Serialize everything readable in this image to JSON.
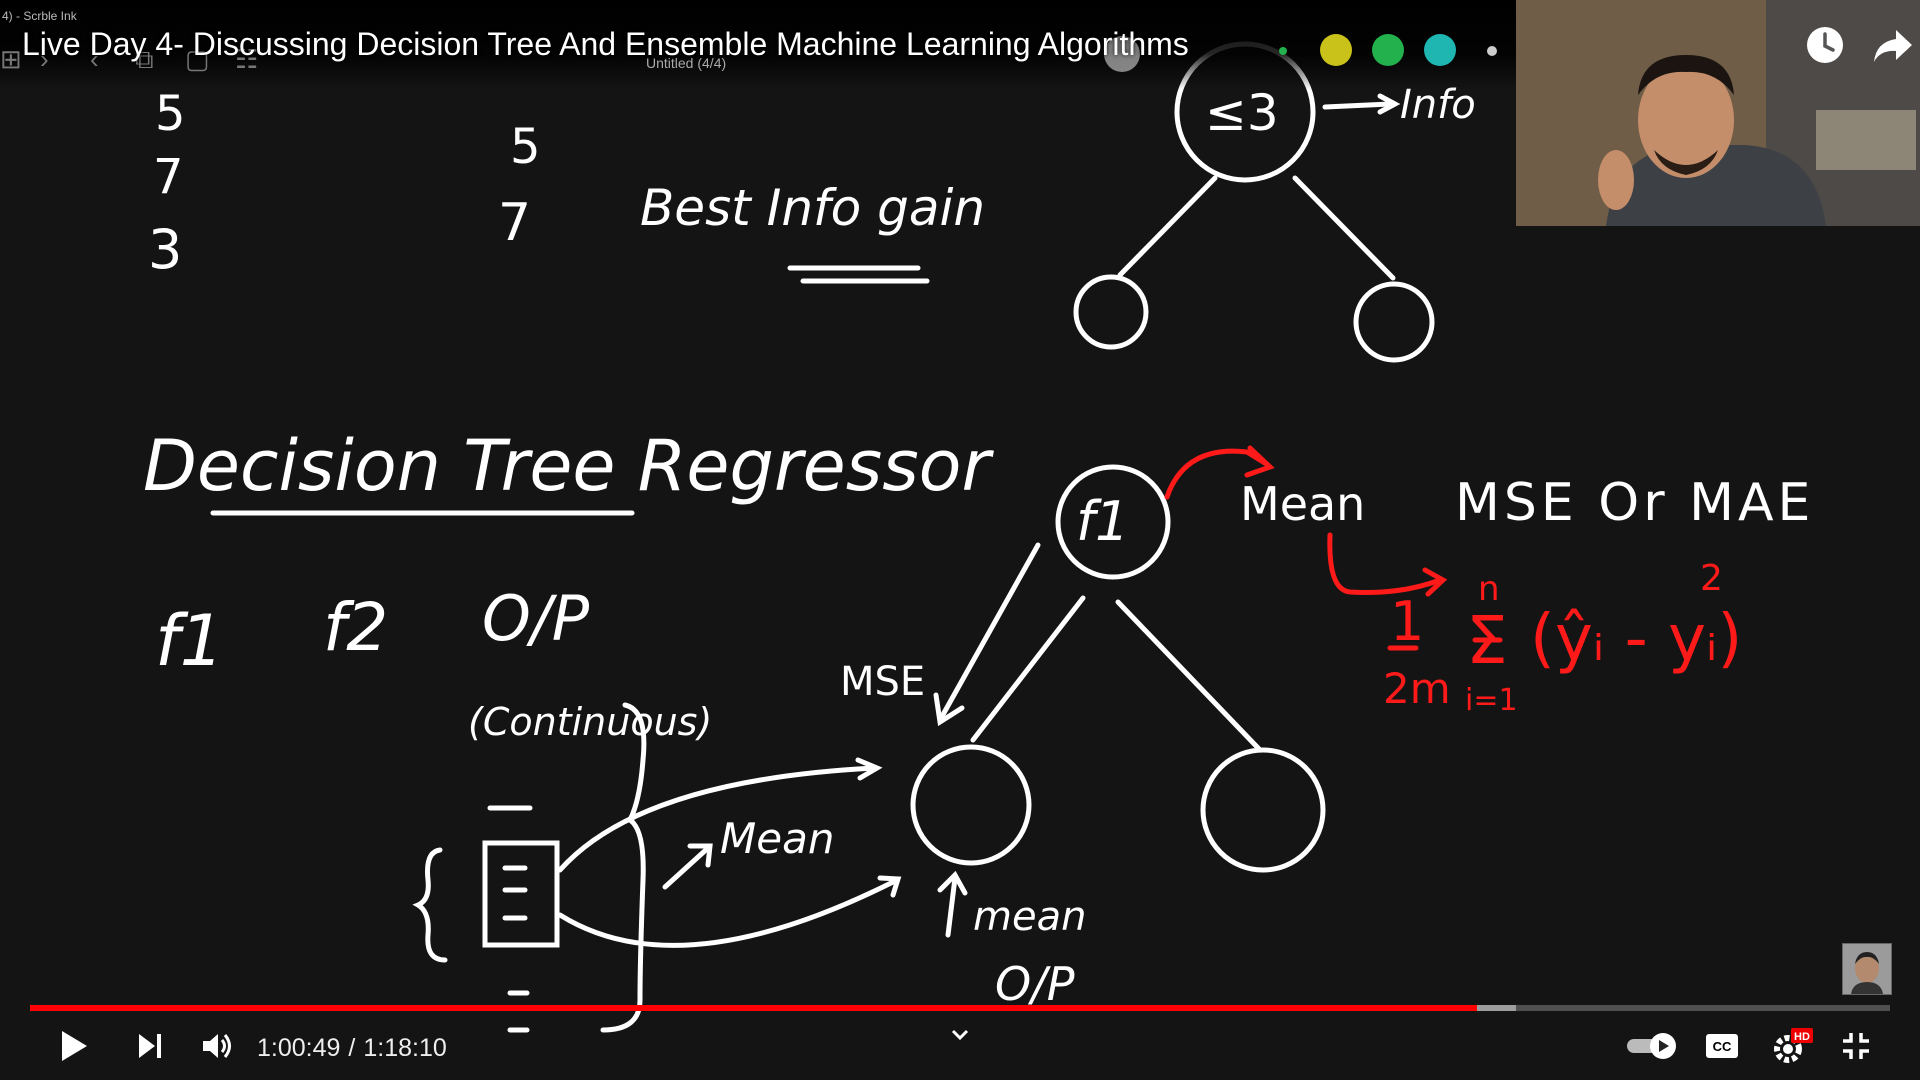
{
  "app": {
    "name": "4) - Scrble Ink",
    "document": "Untitled (4/4)"
  },
  "video": {
    "title": "Live Day 4- Discussing Decision Tree And Ensemble Machine Learning Algorithms",
    "current_time": "1:00:49",
    "duration": "1:18:10",
    "played_fraction": 0.778,
    "buffered_fraction": 0.799,
    "hd_badge": "HD",
    "cc_label": "CC"
  },
  "board": {
    "col1_values": [
      "5",
      "7",
      "3"
    ],
    "col2_values": [
      "5",
      "7"
    ],
    "best_info_gain": "Best Info gain",
    "root_condition": "≤3",
    "root_arrow_note": "Info",
    "heading": "Decision Tree Regressor",
    "features": [
      "f1",
      "f2",
      "O/P"
    ],
    "continuous_label": "(Continuous)",
    "node_label": "f1",
    "mean_label": "Mean",
    "mse_or_mae": "MSE Or MAE",
    "mse_label": "MSE",
    "mean_arrow_label": "Mean",
    "mean_up_label": "mean",
    "op_label": "O/P",
    "formula": {
      "prefix": "1",
      "denominator": "2m",
      "sum_top": "n",
      "sum_symbol": "Σ",
      "sum_bottom": "i=1",
      "body": "(ŷᵢ - yᵢ)",
      "exponent": "2"
    }
  },
  "colors": {
    "ink_white": "#ffffff",
    "ink_red": "#ff1a1a",
    "swatch_yellow": "#c9c21a",
    "swatch_green": "#22b14c",
    "swatch_teal": "#1fb5b0",
    "progress_red": "#ff0000"
  },
  "icons": {
    "play": "play-icon",
    "next": "skip-next-icon",
    "volume": "volume-icon",
    "autoplay": "autoplay-toggle-icon",
    "cc": "captions-icon",
    "settings": "gear-icon",
    "fullscreen_exit": "exit-fullscreen-icon",
    "watch_later": "clock-icon",
    "share": "share-arrow-icon",
    "chevron": "chevron-down-icon"
  }
}
